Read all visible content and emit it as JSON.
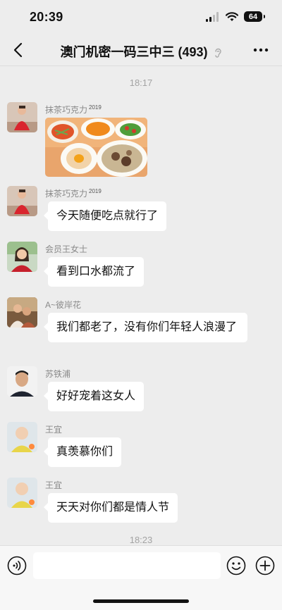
{
  "status_bar": {
    "time": "20:39",
    "battery": "64"
  },
  "header": {
    "title": "澳门机密一码三中三 (493)"
  },
  "timestamps": [
    "18:17",
    "18:23"
  ],
  "messages": [
    {
      "sender": "抹茶巧克力",
      "sender_badge": "2019",
      "type": "image"
    },
    {
      "sender": "抹茶巧克力",
      "sender_badge": "2019",
      "text": "今天随便吃点就行了"
    },
    {
      "sender": "会员王女士",
      "text": "看到口水都流了"
    },
    {
      "sender": "A~彼岸花",
      "text": "我们都老了，没有你们年轻人浪漫了"
    },
    {
      "sender": "苏铁浦",
      "text": "好好宠着这女人"
    },
    {
      "sender": "王宜",
      "text": "真羡慕你们"
    },
    {
      "sender": "王宜",
      "text": "天天对你们都是情人节"
    }
  ],
  "input": {
    "value": "",
    "placeholder": ""
  },
  "colors": {
    "background": "#ededed",
    "bubble": "#ffffff",
    "input_bar": "#f7f7f7"
  }
}
